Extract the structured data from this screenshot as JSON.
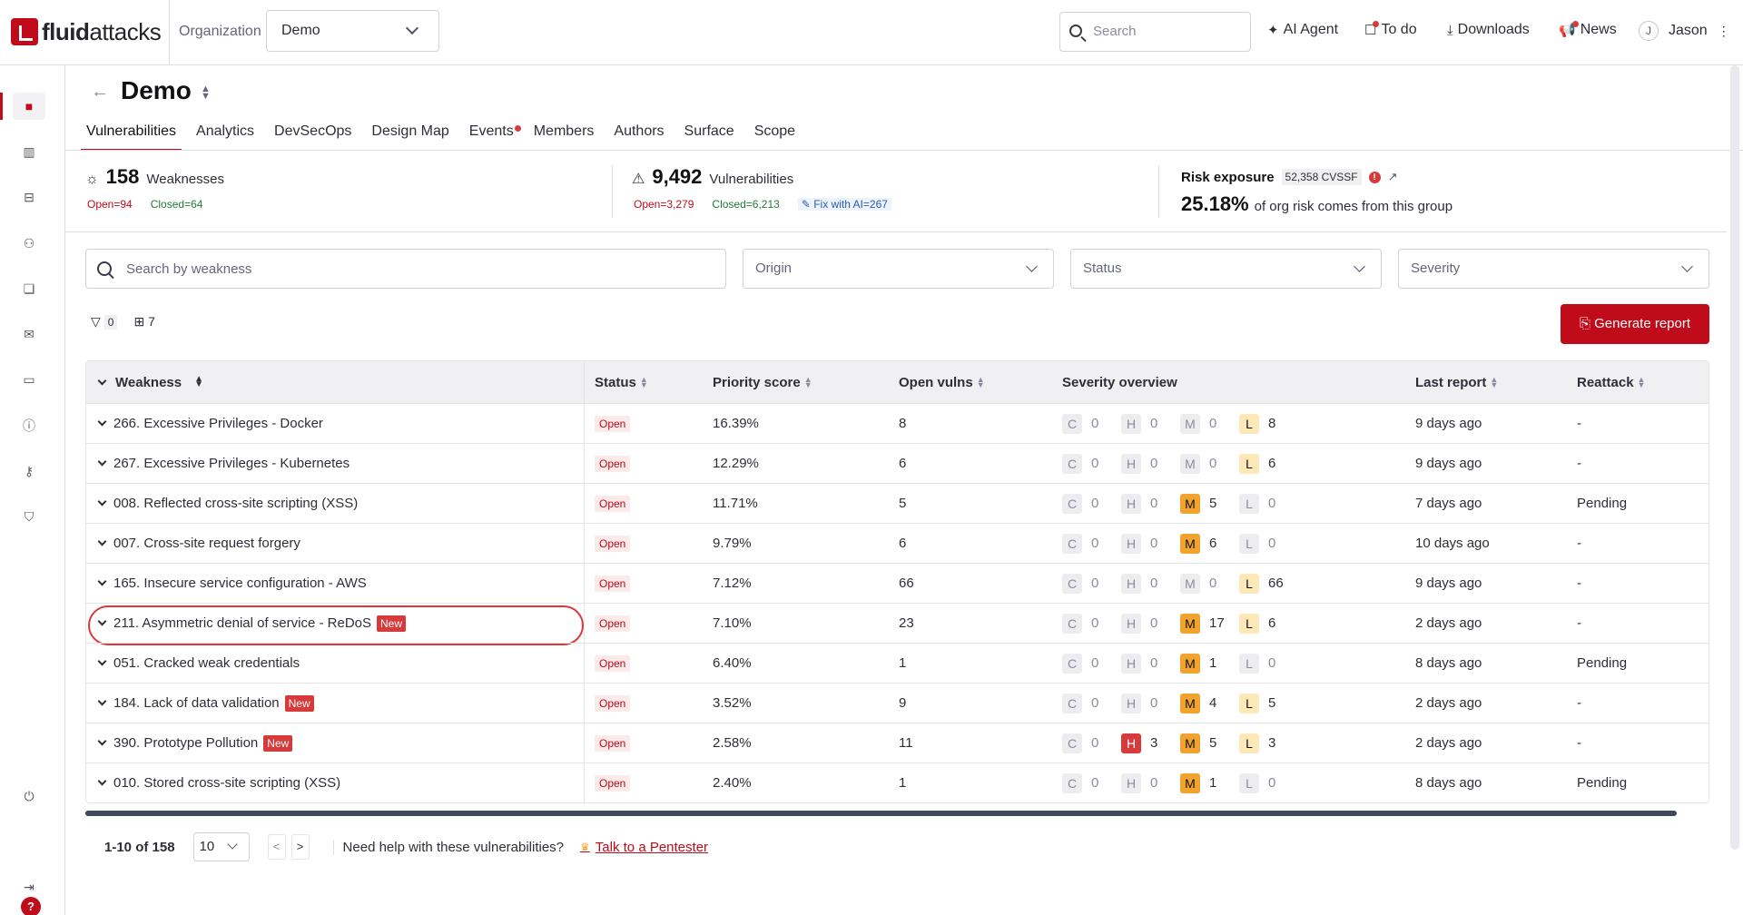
{
  "app": {
    "logo_text_bold": "fluid",
    "logo_text": "attacks",
    "org_label": "Organization",
    "org_value": "Demo"
  },
  "topbar": {
    "search_placeholder": "Search",
    "ai_agent": "AI Agent",
    "todo": "To do",
    "downloads": "Downloads",
    "news": "News",
    "user_initial": "J",
    "user_name": "Jason"
  },
  "page": {
    "title": "Demo",
    "tabs": [
      "Vulnerabilities",
      "Analytics",
      "DevSecOps",
      "Design Map",
      "Events",
      "Members",
      "Authors",
      "Surface",
      "Scope"
    ]
  },
  "summary": {
    "weaknesses": {
      "count": "158",
      "label": "Weaknesses",
      "open": "Open=94",
      "closed": "Closed=64"
    },
    "vulnerabilities": {
      "count": "9,492",
      "label": "Vulnerabilities",
      "open": "Open=3,279",
      "closed": "Closed=6,213",
      "fix": "Fix with AI=267"
    },
    "risk": {
      "title": "Risk exposure",
      "cvssf": "52,358 CVSSF",
      "pct": "25.18%",
      "text": "of org risk comes from this group"
    }
  },
  "filters": {
    "search_placeholder": "Search by weakness",
    "origin": "Origin",
    "status": "Status",
    "severity": "Severity",
    "filter_count": "0",
    "columns_count": "7",
    "generate_report": "Generate report"
  },
  "table": {
    "headers": {
      "weakness": "Weakness",
      "status": "Status",
      "priority": "Priority score",
      "open_vulns": "Open vulns",
      "severity": "Severity overview",
      "last_report": "Last report",
      "reattack": "Reattack"
    },
    "rows": [
      {
        "weakness": "266. Excessive Privileges - Docker",
        "new": "",
        "status": "Open",
        "priority": "16.39%",
        "open_vulns": "8",
        "C": "0",
        "H": "0",
        "M": "0",
        "L": "8",
        "last_report": "9 days ago",
        "reattack": "-"
      },
      {
        "weakness": "267. Excessive Privileges - Kubernetes",
        "new": "",
        "status": "Open",
        "priority": "12.29%",
        "open_vulns": "6",
        "C": "0",
        "H": "0",
        "M": "0",
        "L": "6",
        "last_report": "9 days ago",
        "reattack": "-"
      },
      {
        "weakness": "008. Reflected cross-site scripting (XSS)",
        "new": "",
        "status": "Open",
        "priority": "11.71%",
        "open_vulns": "5",
        "C": "0",
        "H": "0",
        "M": "5",
        "L": "0",
        "last_report": "7 days ago",
        "reattack": "Pending"
      },
      {
        "weakness": "007. Cross-site request forgery",
        "new": "",
        "status": "Open",
        "priority": "9.79%",
        "open_vulns": "6",
        "C": "0",
        "H": "0",
        "M": "6",
        "L": "0",
        "last_report": "10 days ago",
        "reattack": "-"
      },
      {
        "weakness": "165. Insecure service configuration - AWS",
        "new": "",
        "status": "Open",
        "priority": "7.12%",
        "open_vulns": "66",
        "C": "0",
        "H": "0",
        "M": "0",
        "L": "66",
        "last_report": "9 days ago",
        "reattack": "-"
      },
      {
        "weakness": "211. Asymmetric denial of service - ReDoS",
        "new": "New",
        "status": "Open",
        "priority": "7.10%",
        "open_vulns": "23",
        "C": "0",
        "H": "0",
        "M": "17",
        "L": "6",
        "last_report": "2 days ago",
        "reattack": "-"
      },
      {
        "weakness": "051. Cracked weak credentials",
        "new": "",
        "status": "Open",
        "priority": "6.40%",
        "open_vulns": "1",
        "C": "0",
        "H": "0",
        "M": "1",
        "L": "0",
        "last_report": "8 days ago",
        "reattack": "Pending"
      },
      {
        "weakness": "184. Lack of data validation",
        "new": "New",
        "status": "Open",
        "priority": "3.52%",
        "open_vulns": "9",
        "C": "0",
        "H": "0",
        "M": "4",
        "L": "5",
        "last_report": "2 days ago",
        "reattack": "-"
      },
      {
        "weakness": "390. Prototype Pollution",
        "new": "New",
        "status": "Open",
        "priority": "2.58%",
        "open_vulns": "11",
        "C": "0",
        "H": "3",
        "M": "5",
        "L": "3",
        "last_report": "2 days ago",
        "reattack": "-"
      },
      {
        "weakness": "010. Stored cross-site scripting (XSS)",
        "new": "",
        "status": "Open",
        "priority": "2.40%",
        "open_vulns": "1",
        "C": "0",
        "H": "0",
        "M": "1",
        "L": "0",
        "last_report": "8 days ago",
        "reattack": "Pending"
      }
    ]
  },
  "pagination": {
    "range": "1-10 of 158",
    "page_size": "10",
    "help_text": "Need help with these vulnerabilities?",
    "link": "Talk to a Pentester"
  },
  "colors": {
    "brand": "#bf0b1a",
    "high": "#d63a3a",
    "medium": "#f2a22e",
    "low": "#fde9b8"
  }
}
